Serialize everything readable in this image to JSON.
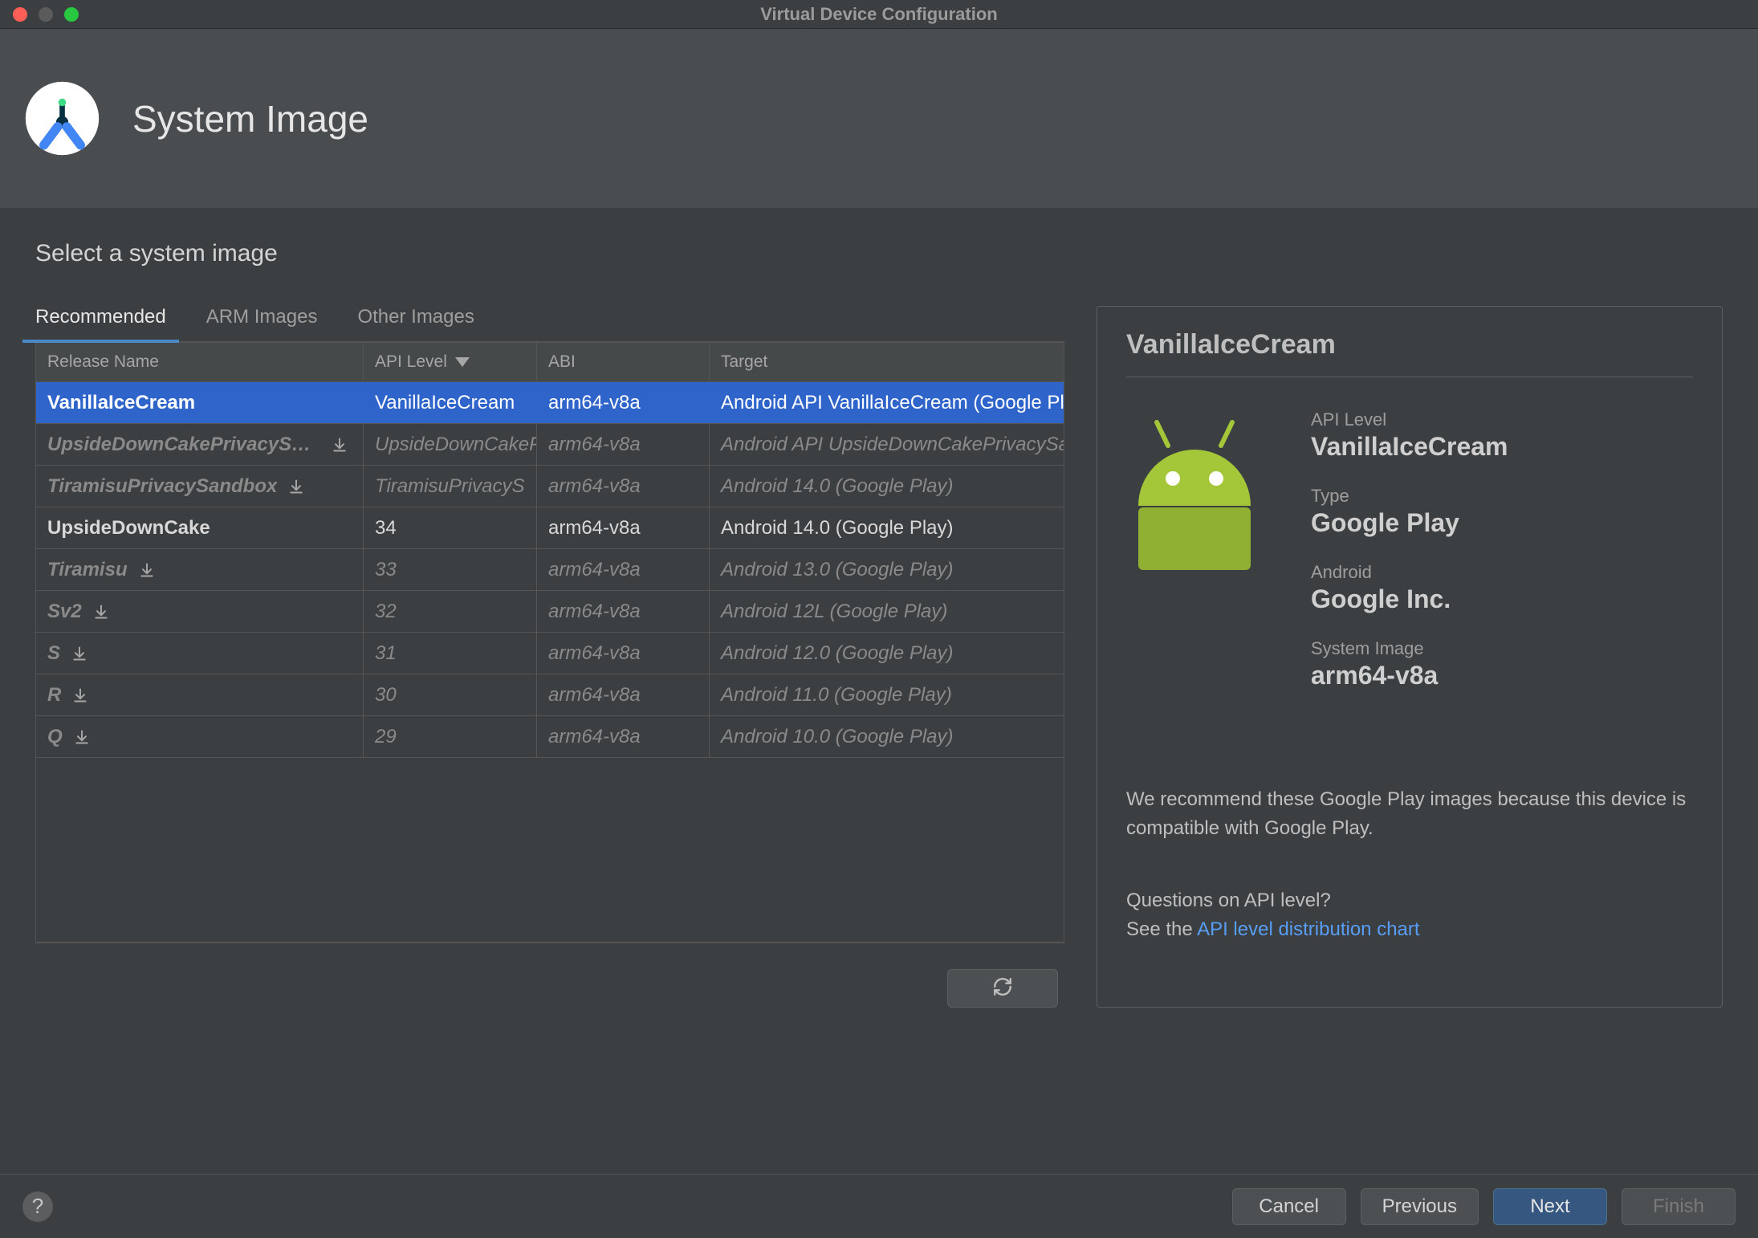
{
  "window": {
    "title": "Virtual Device Configuration"
  },
  "header": {
    "title": "System Image"
  },
  "subtitle": "Select a system image",
  "tabs": [
    {
      "label": "Recommended",
      "active": true
    },
    {
      "label": "ARM Images",
      "active": false
    },
    {
      "label": "Other Images",
      "active": false
    }
  ],
  "table": {
    "columns": {
      "release": "Release Name",
      "api": "API Level",
      "abi": "ABI",
      "target": "Target"
    },
    "rows": [
      {
        "release": "VanillaIceCream",
        "api": "VanillaIceCream",
        "abi": "arm64-v8a",
        "target": "Android API VanillaIceCream (Google Play)",
        "state": "selected",
        "download": false
      },
      {
        "release": "UpsideDownCakePrivacySandbox",
        "api": "UpsideDownCakePS",
        "abi": "arm64-v8a",
        "target": "Android API UpsideDownCakePrivacySandbox",
        "state": "dim",
        "download": true
      },
      {
        "release": "TiramisuPrivacySandbox",
        "api": "TiramisuPrivacyS",
        "abi": "arm64-v8a",
        "target": "Android 14.0 (Google Play)",
        "state": "dim",
        "download": true
      },
      {
        "release": "UpsideDownCake",
        "api": "34",
        "abi": "arm64-v8a",
        "target": "Android 14.0 (Google Play)",
        "state": "available",
        "download": false
      },
      {
        "release": "Tiramisu",
        "api": "33",
        "abi": "arm64-v8a",
        "target": "Android 13.0 (Google Play)",
        "state": "dim",
        "download": true
      },
      {
        "release": "Sv2",
        "api": "32",
        "abi": "arm64-v8a",
        "target": "Android 12L (Google Play)",
        "state": "dim",
        "download": true
      },
      {
        "release": "S",
        "api": "31",
        "abi": "arm64-v8a",
        "target": "Android 12.0 (Google Play)",
        "state": "dim",
        "download": true
      },
      {
        "release": "R",
        "api": "30",
        "abi": "arm64-v8a",
        "target": "Android 11.0 (Google Play)",
        "state": "dim",
        "download": true
      },
      {
        "release": "Q",
        "api": "29",
        "abi": "arm64-v8a",
        "target": "Android 10.0 (Google Play)",
        "state": "dim",
        "download": true
      }
    ]
  },
  "detail": {
    "title": "VanillaIceCream",
    "fields": {
      "api_label": "API Level",
      "api_value": "VanillaIceCream",
      "type_label": "Type",
      "type_value": "Google Play",
      "android_label": "Android",
      "android_value": "Google Inc.",
      "sysimg_label": "System Image",
      "sysimg_value": "arm64-v8a"
    },
    "note": "We recommend these Google Play images because this device is compatible with Google Play.",
    "question": "Questions on API level?",
    "see_prefix": "See the ",
    "see_link": "API level distribution chart"
  },
  "footer": {
    "cancel": "Cancel",
    "previous": "Previous",
    "next": "Next",
    "finish": "Finish"
  }
}
